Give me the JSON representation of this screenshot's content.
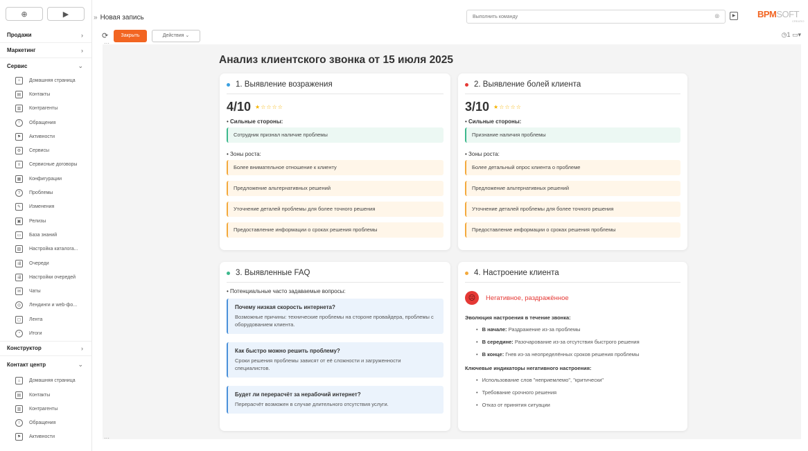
{
  "sidebar": {
    "top_buttons": {
      "add": "⊕",
      "play": "▶"
    },
    "sections": [
      {
        "label": "Продажи",
        "chevron": "›"
      },
      {
        "label": "Маркетинг",
        "chevron": "›"
      },
      {
        "label": "Сервис",
        "chevron": "⌄"
      }
    ],
    "service_items": [
      {
        "label": "Домашняя страница",
        "icon": "home-icon"
      },
      {
        "label": "Контакты",
        "icon": "contacts-icon"
      },
      {
        "label": "Контрагенты",
        "icon": "accounts-icon"
      },
      {
        "label": "Обращения",
        "icon": "cases-icon"
      },
      {
        "label": "Активности",
        "icon": "flag-icon"
      },
      {
        "label": "Сервисы",
        "icon": "gear-icon"
      },
      {
        "label": "Сервисные договоры",
        "icon": "contract-icon"
      },
      {
        "label": "Конфигурации",
        "icon": "config-icon"
      },
      {
        "label": "Проблемы",
        "icon": "problem-icon"
      },
      {
        "label": "Изменения",
        "icon": "pen-icon"
      },
      {
        "label": "Релизы",
        "icon": "release-icon"
      },
      {
        "label": "База знаний",
        "icon": "knowledge-icon"
      },
      {
        "label": "Настройка каталога...",
        "icon": "catalog-icon"
      },
      {
        "label": "Очереди",
        "icon": "queue-icon"
      },
      {
        "label": "Настройки очередей",
        "icon": "queue-settings-icon"
      },
      {
        "label": "Чаты",
        "icon": "chat-icon"
      },
      {
        "label": "Лендинги и web-фо...",
        "icon": "landing-icon"
      },
      {
        "label": "Лента",
        "icon": "feed-icon"
      },
      {
        "label": "Итоги",
        "icon": "results-icon"
      }
    ],
    "constructor_section": {
      "label": "Конструктор",
      "chevron": "›"
    },
    "contact_center_section": {
      "label": "Контакт центр",
      "chevron": "⌄"
    },
    "contact_center_items": [
      {
        "label": "Домашняя страница",
        "icon": "home-icon"
      },
      {
        "label": "Контакты",
        "icon": "contacts-icon"
      },
      {
        "label": "Контрагенты",
        "icon": "accounts-icon"
      },
      {
        "label": "Обращения",
        "icon": "cases-icon"
      },
      {
        "label": "Активности",
        "icon": "flag-icon"
      }
    ]
  },
  "topbar": {
    "breadcrumb_arrows": "»",
    "title": "Новая запись",
    "command_placeholder": "Выполнить команду",
    "logo_main": "BPM",
    "logo_soft": "SOFT",
    "logo_sub": "CREATIO"
  },
  "actions": {
    "close_label": "Закрыть",
    "actions_label": "Действия ⌄",
    "notifications_count": "1"
  },
  "report": {
    "title": "Анализ клиентского звонка от 15 июля 2025",
    "card1": {
      "title": "1. Выявление возражения",
      "dot_color": "#3aa0e0",
      "score": "4/10",
      "strengths_label": "Сильные стороны:",
      "strengths": [
        "Сотрудник признал наличие проблемы"
      ],
      "growth_label": "Зоны роста:",
      "growth": [
        "Более внимательное отношение к клиенту",
        "Предложение альтернативных решений",
        "Уточнение деталей проблемы для более точного решения",
        "Предоставление информации о сроках решения проблемы"
      ]
    },
    "card2": {
      "title": "2. Выявление болей клиента",
      "dot_color": "#e53935",
      "score": "3/10",
      "strengths_label": "Сильные стороны:",
      "strengths": [
        "Признание наличия проблемы"
      ],
      "growth_label": "Зоны роста:",
      "growth": [
        "Более детальный опрос клиента о проблеме",
        "Предложение альтернативных решений",
        "Уточнение деталей проблемы для более точного решения",
        "Предоставление информации о сроках решения проблемы"
      ]
    },
    "card3": {
      "title": "3. Выявленные FAQ",
      "dot_color": "#3cb88c",
      "subtitle": "Потенциальные часто задаваемые вопросы:",
      "faqs": [
        {
          "q": "Почему низкая скорость интернета?",
          "a": "Возможные причины: технические проблемы на стороне провайдера, проблемы с оборудованием клиента."
        },
        {
          "q": "Как быстро можно решить проблему?",
          "a": "Сроки решения проблемы зависят от её сложности и загруженности специалистов."
        },
        {
          "q": "Будет ли перерасчёт за нерабочий интернет?",
          "a": "Перерасчёт возможен в случае длительного отсутствия услуги."
        }
      ]
    },
    "card4": {
      "title": "4. Настроение клиента",
      "dot_color": "#f3a93c",
      "mood": "Негативное, раздражённое",
      "evolution_label": "Эволюция настроения в течение звонка:",
      "evolution": [
        {
          "k": "В начале:",
          "v": "Раздражение из-за проблемы"
        },
        {
          "k": "В середине:",
          "v": "Разочарование из-за отсутствия быстрого решения"
        },
        {
          "k": "В конце:",
          "v": "Гнев из-за неопределённых сроков решения проблемы"
        }
      ],
      "indicators_label": "Ключевые индикаторы негативного настроения:",
      "indicators": [
        "Использование слов \"неприемлемо\", \"критически\"",
        "Требование срочного решения",
        "Отказ от принятия ситуации"
      ]
    }
  }
}
